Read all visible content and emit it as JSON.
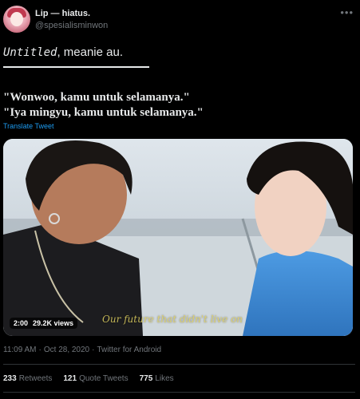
{
  "author": {
    "display_name": "Lip — hiatus.",
    "handle": "@spesialisminwon"
  },
  "tweet": {
    "title_italic": "Untitled",
    "title_rest": ", meanie au.",
    "quote_line_1": "\"Wonwoo, kamu untuk selamanya.\"",
    "quote_line_2": "\"Iya mingyu, kamu untuk selamanya.\"",
    "translate_label": "Translate Tweet"
  },
  "media": {
    "duration": "2:00",
    "views": "29.2K views",
    "subtitle_text": "Our future that didn't live on"
  },
  "meta": {
    "time": "11:09 AM",
    "date": "Oct 28, 2020",
    "source": "Twitter for Android",
    "separator": "·"
  },
  "stats": {
    "retweets_count": "233",
    "retweets_label": "Retweets",
    "quote_count": "121",
    "quote_label": "Quote Tweets",
    "likes_count": "775",
    "likes_label": "Likes"
  },
  "colors": {
    "background": "#000000",
    "text": "#e7e9ea",
    "muted": "#71767b",
    "link": "#1d9bf0"
  }
}
